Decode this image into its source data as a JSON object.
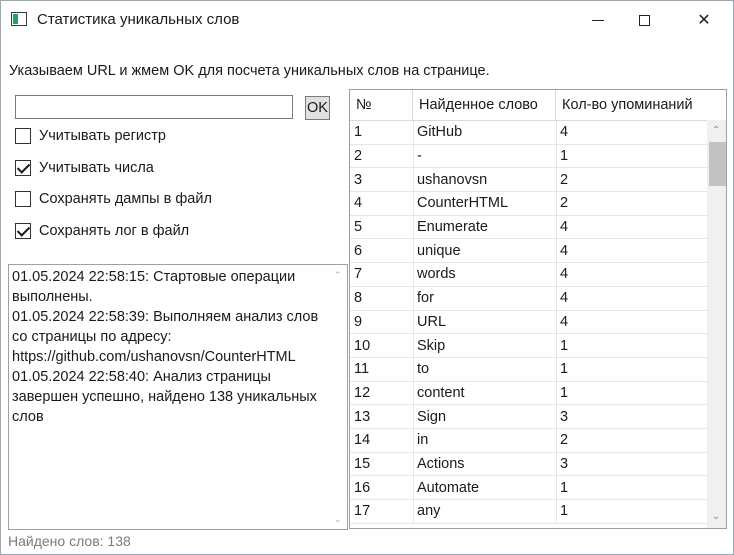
{
  "window": {
    "title": "Статистика уникальных слов",
    "minimize_glyph": "",
    "close_glyph": "✕"
  },
  "instruction": "Указываем URL и жмем OK для посчета уникальных слов на странице.",
  "url_input": {
    "value": "",
    "placeholder": ""
  },
  "ok_button": "OK",
  "checkboxes": [
    {
      "label": "Учитывать регистр",
      "checked": false
    },
    {
      "label": "Учитывать числа",
      "checked": true
    },
    {
      "label": "Сохранять дампы в файл",
      "checked": false
    },
    {
      "label": "Сохранять лог в файл",
      "checked": true
    }
  ],
  "log": {
    "text": "01.05.2024 22:58:15: Стартовые операции выполнены.\n01.05.2024 22:58:39: Выполняем анализ слов со страницы по адресу: https://github.com/ushanovsn/CounterHTML\n01.05.2024 22:58:40: Анализ страницы завершен успешно, найдено 138 уникальных слов",
    "scroll_up": "⌃",
    "scroll_down": "⌄"
  },
  "status": "Найдено слов: 138",
  "table": {
    "headers": [
      "№",
      "Найденное слово",
      "Кол-во упоминаний"
    ],
    "rows": [
      [
        "1",
        "GitHub",
        "4"
      ],
      [
        "2",
        "-",
        "1"
      ],
      [
        "3",
        "ushanovsn",
        "2"
      ],
      [
        "4",
        "CounterHTML",
        "2"
      ],
      [
        "5",
        "Enumerate",
        "4"
      ],
      [
        "6",
        "unique",
        "4"
      ],
      [
        "7",
        "words",
        "4"
      ],
      [
        "8",
        "for",
        "4"
      ],
      [
        "9",
        "URL",
        "4"
      ],
      [
        "10",
        "Skip",
        "1"
      ],
      [
        "11",
        "to",
        "1"
      ],
      [
        "12",
        "content",
        "1"
      ],
      [
        "13",
        "Sign",
        "3"
      ],
      [
        "14",
        "in",
        "2"
      ],
      [
        "15",
        "Actions",
        "3"
      ],
      [
        "16",
        "Automate",
        "1"
      ],
      [
        "17",
        "any",
        "1"
      ]
    ],
    "scroll_up": "⌃",
    "scroll_down": "⌄"
  },
  "colors": {
    "checkmark": "#1a1a1a",
    "status_text": "#7a7a7a",
    "scroll_thumb": "#c2c2c2",
    "app_icon_accent": "#2a9d6a"
  },
  "icons": [
    "app-icon",
    "minimize-icon",
    "maximize-icon",
    "close-icon",
    "checkmark-icon",
    "scroll-up-arrow-icon",
    "scroll-down-arrow-icon"
  ]
}
